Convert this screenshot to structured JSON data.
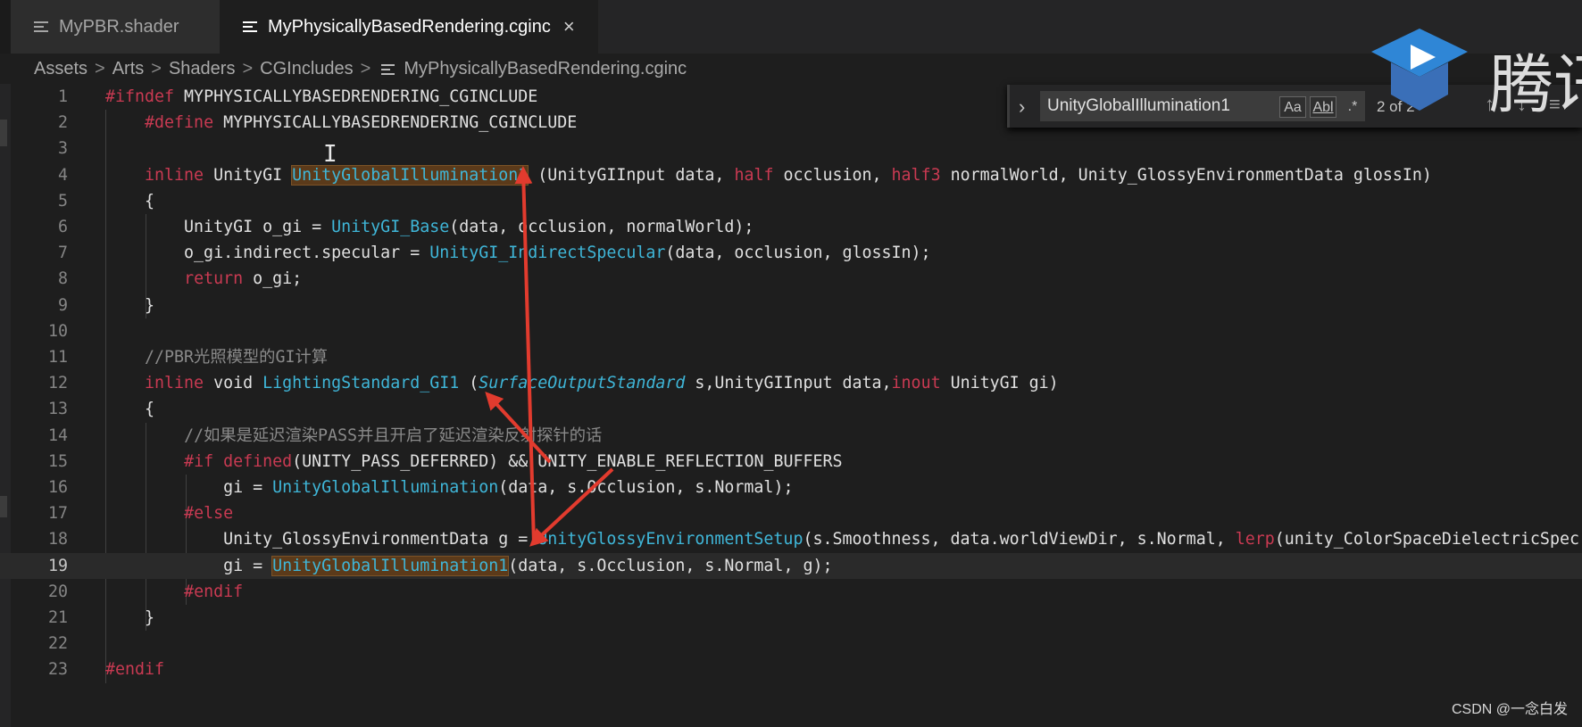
{
  "tabs": [
    {
      "label": "MyPBR.shader",
      "active": false
    },
    {
      "label": "MyPhysicallyBasedRendering.cginc",
      "active": true,
      "close_glyph": "×"
    }
  ],
  "breadcrumb": [
    "Assets",
    "Arts",
    "Shaders",
    "CGIncludes",
    "MyPhysicallyBasedRendering.cginc"
  ],
  "breadcrumb_separator": ">",
  "find_widget": {
    "toggle_glyph": "›",
    "value": "UnityGlobalIllumination1",
    "match_case": "Aa",
    "whole_word": "Abl",
    "regex": ".*",
    "count": "2 of 2",
    "prev_glyph": "↑",
    "next_glyph": "↓",
    "selection_glyph": "≡"
  },
  "logo_text": "腾讯",
  "watermark": "CSDN @一念白发",
  "current_line": 19,
  "colors": {
    "keyword": "#c93a52",
    "function": "#3fb6d8",
    "comment": "#8a8a8a",
    "arrow": "#e23b2e",
    "find_highlight": "#5b3a1a"
  },
  "code_lines": [
    {
      "n": "1",
      "tokens": [
        [
          "pp",
          "#ifndef"
        ],
        [
          "tx",
          " MYPHYSICALLYBASEDRENDERING_CGINCLUDE"
        ]
      ]
    },
    {
      "n": "2",
      "tokens": [
        [
          "tx",
          "    "
        ],
        [
          "pp",
          "#define"
        ],
        [
          "tx",
          " MYPHYSICALLYBASEDRENDERING_CGINCLUDE"
        ]
      ]
    },
    {
      "n": "3",
      "tokens": []
    },
    {
      "n": "4",
      "tokens": [
        [
          "tx",
          "    "
        ],
        [
          "kw",
          "inline"
        ],
        [
          "tx",
          " UnityGI "
        ],
        [
          "hl",
          "UnityGlobalIllumination1"
        ],
        [
          "tx",
          " (UnityGIInput data, "
        ],
        [
          "kw",
          "half"
        ],
        [
          "tx",
          " occlusion, "
        ],
        [
          "kw",
          "half3"
        ],
        [
          "tx",
          " normalWorld, Unity_GlossyEnvironmentData glossIn)"
        ]
      ]
    },
    {
      "n": "5",
      "tokens": [
        [
          "tx",
          "    {"
        ]
      ]
    },
    {
      "n": "6",
      "tokens": [
        [
          "tx",
          "        UnityGI o_gi = "
        ],
        [
          "fn",
          "UnityGI_Base"
        ],
        [
          "tx",
          "(data, occlusion, normalWorld);"
        ]
      ]
    },
    {
      "n": "7",
      "tokens": [
        [
          "tx",
          "        o_gi.indirect.specular = "
        ],
        [
          "fn",
          "UnityGI_IndirectSpecular"
        ],
        [
          "tx",
          "(data, occlusion, glossIn);"
        ]
      ]
    },
    {
      "n": "8",
      "tokens": [
        [
          "tx",
          "        "
        ],
        [
          "kw",
          "return"
        ],
        [
          "tx",
          " o_gi;"
        ]
      ]
    },
    {
      "n": "9",
      "tokens": [
        [
          "tx",
          "    }"
        ]
      ]
    },
    {
      "n": "10",
      "tokens": []
    },
    {
      "n": "11",
      "tokens": [
        [
          "tx",
          "    "
        ],
        [
          "cm",
          "//PBR光照模型的GI计算"
        ]
      ]
    },
    {
      "n": "12",
      "tokens": [
        [
          "tx",
          "    "
        ],
        [
          "kw",
          "inline"
        ],
        [
          "tx",
          " void "
        ],
        [
          "fn",
          "LightingStandard_GI1"
        ],
        [
          "tx",
          " ("
        ],
        [
          "ty",
          "SurfaceOutputStandard"
        ],
        [
          "tx",
          " s,UnityGIInput data,"
        ],
        [
          "kw",
          "inout"
        ],
        [
          "tx",
          " UnityGI gi)"
        ]
      ]
    },
    {
      "n": "13",
      "tokens": [
        [
          "tx",
          "    {"
        ]
      ]
    },
    {
      "n": "14",
      "tokens": [
        [
          "tx",
          "        "
        ],
        [
          "cm",
          "//如果是延迟渲染PASS并且开启了延迟渲染反射探针的话"
        ]
      ]
    },
    {
      "n": "15",
      "tokens": [
        [
          "tx",
          "        "
        ],
        [
          "pp",
          "#if"
        ],
        [
          "tx",
          " "
        ],
        [
          "kw",
          "defined"
        ],
        [
          "tx",
          "(UNITY_PASS_DEFERRED) && UNITY_ENABLE_REFLECTION_BUFFERS"
        ]
      ]
    },
    {
      "n": "16",
      "tokens": [
        [
          "tx",
          "            gi = "
        ],
        [
          "fn",
          "UnityGlobalIllumination"
        ],
        [
          "tx",
          "(data, s.Occlusion, s.Normal);"
        ]
      ]
    },
    {
      "n": "17",
      "tokens": [
        [
          "tx",
          "        "
        ],
        [
          "pp",
          "#else"
        ]
      ]
    },
    {
      "n": "18",
      "tokens": [
        [
          "tx",
          "            Unity_GlossyEnvironmentData g = "
        ],
        [
          "fn",
          "UnityGlossyEnvironmentSetup"
        ],
        [
          "tx",
          "(s.Smoothness, data.worldViewDir, s.Normal, "
        ],
        [
          "kw",
          "lerp"
        ],
        [
          "tx",
          "(unity_ColorSpaceDielectricSpec"
        ]
      ]
    },
    {
      "n": "19",
      "tokens": [
        [
          "tx",
          "            gi = "
        ],
        [
          "fnhl",
          "UnityGlobalIllumination1"
        ],
        [
          "tx",
          "(data, s.Occlusion, s.Normal, g);"
        ]
      ]
    },
    {
      "n": "20",
      "tokens": [
        [
          "tx",
          "        "
        ],
        [
          "pp",
          "#endif"
        ]
      ]
    },
    {
      "n": "21",
      "tokens": [
        [
          "tx",
          "    }"
        ]
      ]
    },
    {
      "n": "22",
      "tokens": []
    },
    {
      "n": "23",
      "tokens": [
        [
          "pp",
          "#endif"
        ]
      ]
    }
  ]
}
